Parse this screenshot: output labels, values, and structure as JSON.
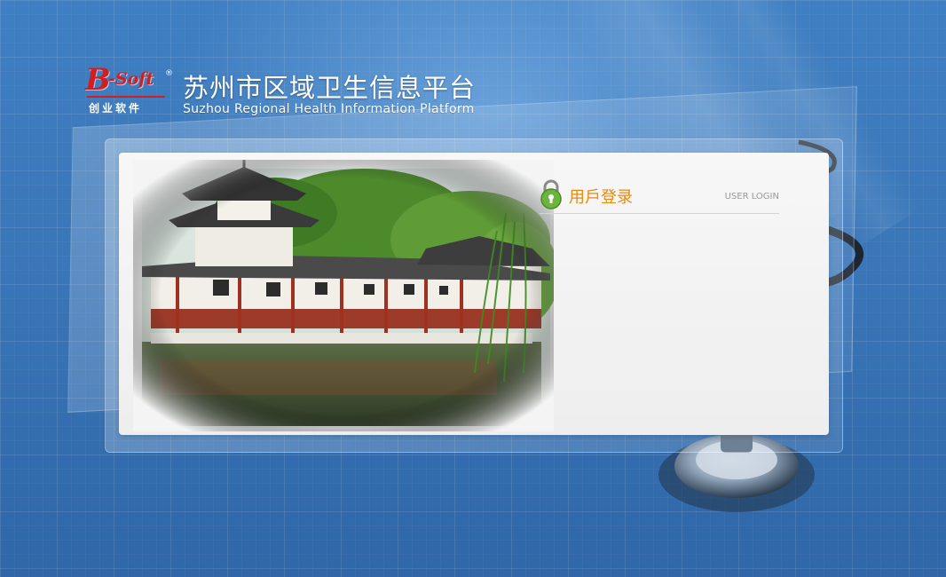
{
  "header": {
    "logo": {
      "brand_b": "B",
      "brand_soft": "-Soft",
      "registered_mark": "®",
      "company_cn": "创业软件"
    },
    "title_cn": "苏州市区域卫生信息平台",
    "title_en": "Suzhou Regional Health Information Platform"
  },
  "login": {
    "title": "用戶登录",
    "subtitle": "USER LOGIN",
    "icon": "lock-icon"
  },
  "colors": {
    "background": "#3a76b8",
    "login_title": "#e58a12",
    "logo_red": "#d11f1f"
  }
}
